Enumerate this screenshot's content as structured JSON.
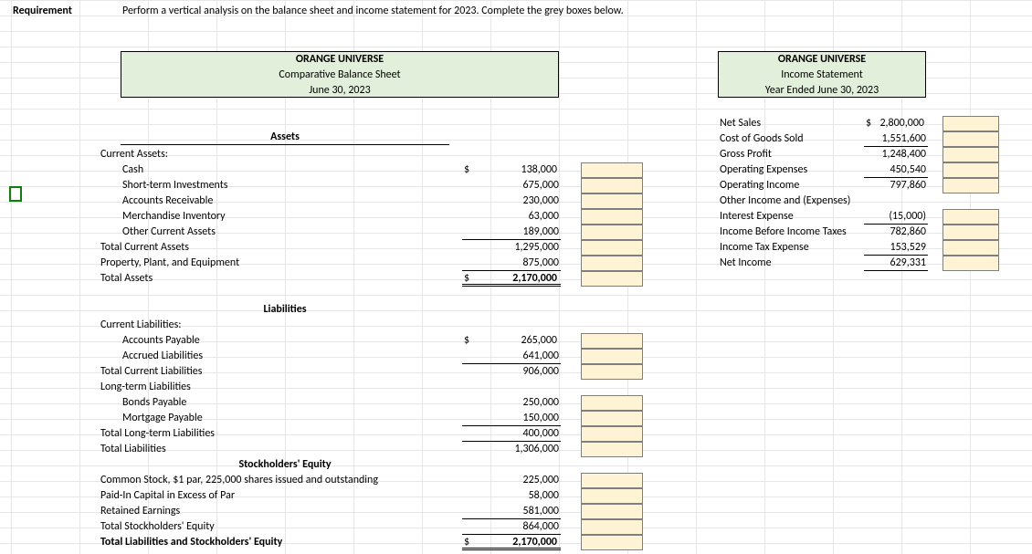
{
  "requirement_label": "Requirement",
  "requirement_text": "Perform a vertical analysis on the balance sheet and income statement for 2023. Complete the grey boxes below.",
  "bs": {
    "company": "ORANGE UNIVERSE",
    "title": "Comparative Balance Sheet",
    "date": "June 30, 2023",
    "assets_header": "Assets",
    "current_assets_label": "Current Assets:",
    "cash": {
      "label": "Cash",
      "value": "138,000",
      "sym": "$"
    },
    "sti": {
      "label": "Short-term Investments",
      "value": "675,000"
    },
    "ar": {
      "label": "Accounts Receivable",
      "value": "230,000"
    },
    "inv": {
      "label": "Merchandise Inventory",
      "value": "63,000"
    },
    "oca": {
      "label": "Other Current Assets",
      "value": "189,000"
    },
    "tca": {
      "label": "Total Current Assets",
      "value": "1,295,000"
    },
    "ppe": {
      "label": "Property, Plant, and Equipment",
      "value": "875,000"
    },
    "ta": {
      "label": "Total Assets",
      "value": "2,170,000",
      "sym": "$"
    },
    "liab_header": "Liabilities",
    "cl_label": "Current Liabilities:",
    "ap": {
      "label": "Accounts Payable",
      "value": "265,000",
      "sym": "$"
    },
    "al": {
      "label": "Accrued Liabilities",
      "value": "641,000"
    },
    "tcl": {
      "label": "Total Current Liabilities",
      "value": "906,000"
    },
    "ltl_label": "Long-term Liabilities",
    "bp": {
      "label": "Bonds Payable",
      "value": "250,000"
    },
    "mp": {
      "label": "Mortgage Payable",
      "value": "150,000"
    },
    "tltl": {
      "label": "Total Long-term Liabilities",
      "value": "400,000"
    },
    "tl": {
      "label": "Total Liabilities",
      "value": "1,306,000"
    },
    "se_header": "Stockholders' Equity",
    "cs": {
      "label": "Common Stock, $1 par, 225,000 shares issued and outstanding",
      "value": "225,000"
    },
    "pic": {
      "label": "Paid-In Capital in Excess of Par",
      "value": "58,000"
    },
    "re": {
      "label": "Retained Earnings",
      "value": "581,000"
    },
    "tse": {
      "label": "Total Stockholders' Equity",
      "value": "864,000"
    },
    "tlse": {
      "label": "Total Liabilities and Stockholders' Equity",
      "value": "2,170,000",
      "sym": "$"
    }
  },
  "is": {
    "company": "ORANGE UNIVERSE",
    "title": "Income Statement",
    "date": "Year Ended June 30, 2023",
    "ns": {
      "label": "Net Sales",
      "value": "2,800,000",
      "sym": "$"
    },
    "cogs": {
      "label": "Cost of Goods Sold",
      "value": "1,551,600"
    },
    "gp": {
      "label": "Gross Profit",
      "value": "1,248,400"
    },
    "opex": {
      "label": "Operating Expenses",
      "value": "450,540"
    },
    "opinc": {
      "label": "Operating Income",
      "value": "797,860"
    },
    "oie": {
      "label": "Other Income and (Expenses)"
    },
    "intexp": {
      "label": "Interest Expense",
      "value": "(15,000)"
    },
    "ibt": {
      "label": "Income Before Income Taxes",
      "value": "782,860"
    },
    "tax": {
      "label": "Income Tax Expense",
      "value": "153,529"
    },
    "ni": {
      "label": "Net Income",
      "value": "629,331"
    }
  }
}
